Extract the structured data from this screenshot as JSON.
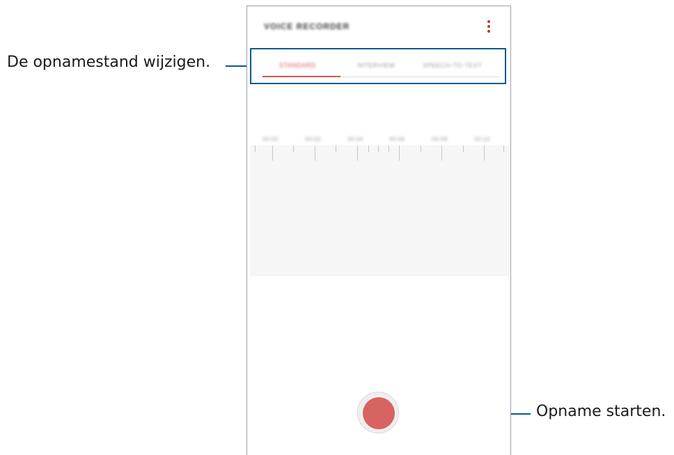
{
  "callouts": {
    "mode": "De opnamestand wijzigen.",
    "record": "Opname starten."
  },
  "app": {
    "title": "VOICE RECORDER",
    "menu_icon": "more-vert-icon"
  },
  "tabs": [
    {
      "label": "STANDARD",
      "active": true
    },
    {
      "label": "INTERVIEW",
      "active": false
    },
    {
      "label": "SPEECH-TO-TEXT",
      "active": false
    }
  ],
  "timeline": {
    "timestamps": [
      "00:00",
      "00:02",
      "00:04",
      "00:06",
      "00:08",
      "00:10"
    ]
  },
  "colors": {
    "accent": "#d0574f",
    "callout_line": "#0b5a8a",
    "record": "#d86462"
  }
}
